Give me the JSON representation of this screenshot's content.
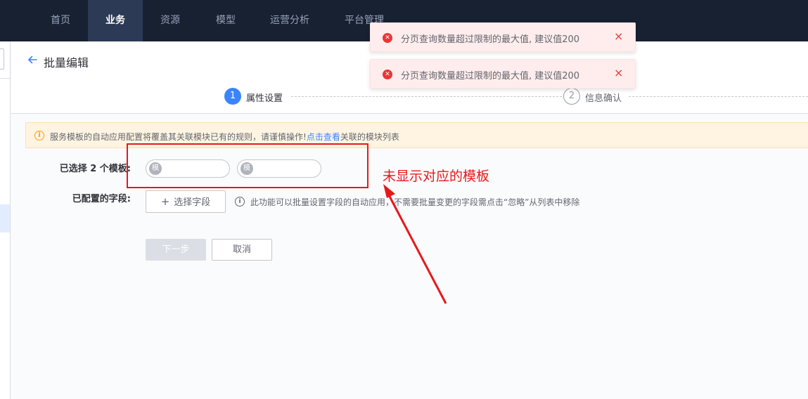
{
  "nav": {
    "items": [
      {
        "label": "首页",
        "active": false
      },
      {
        "label": "业务",
        "active": true
      },
      {
        "label": "资源",
        "active": false
      },
      {
        "label": "模型",
        "active": false
      },
      {
        "label": "运营分析",
        "active": false
      },
      {
        "label": "平台管理",
        "active": false
      }
    ]
  },
  "header": {
    "title": "批量编辑"
  },
  "steps": [
    {
      "number": "1",
      "label": "属性设置",
      "active": true
    },
    {
      "number": "2",
      "label": "信息确认",
      "active": false
    }
  ],
  "alert": {
    "text_before": "服务模板的自动应用配置将覆盖其关联模块已有的规则，请谨慎操作!",
    "link": "点击查看",
    "text_after": "关联的模块列表"
  },
  "form": {
    "templates_label": "已选择 2 个模板:",
    "templates": [
      {
        "avatar": "模",
        "name": ""
      },
      {
        "avatar": "模",
        "name": ""
      }
    ],
    "fields_label": "已配置的字段:",
    "select_field_button": "选择字段",
    "plus_glyph": "+",
    "info_text": "此功能可以批量设置字段的自动应用，不需要批量变更的字段需点击“忽略”从列表中移除"
  },
  "buttons": {
    "next": "下一步",
    "cancel": "取消"
  },
  "toasts": [
    {
      "text": "分页查询数量超过限制的最大值, 建议值200",
      "close": "×"
    },
    {
      "text": "分页查询数量超过限制的最大值, 建议值200",
      "close": "×"
    }
  ],
  "annotation": {
    "text": "未显示对应的模板"
  },
  "colors": {
    "nav_bg": "#182132",
    "primary": "#3a84ff",
    "error": "#ea3636",
    "annotation_red": "#e8181a",
    "warning": "#ff9c01"
  }
}
